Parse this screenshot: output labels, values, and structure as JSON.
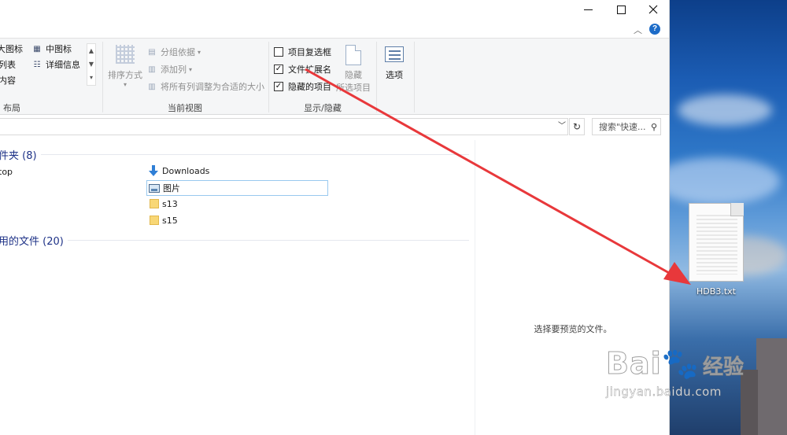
{
  "window": {
    "controls": [
      "minimize",
      "maximize",
      "close"
    ]
  },
  "ribbon": {
    "layout": {
      "items": [
        "大图标",
        "中图标",
        "列表",
        "详细信息",
        "内容"
      ],
      "label": "布局"
    },
    "current_view": {
      "sort_label": "排序方式",
      "group_by_label": "分组依据",
      "add_column_label": "添加列",
      "fit_columns_label": "将所有列调整为合适的大小",
      "label": "当前视图"
    },
    "show_hide": {
      "item_checkboxes_label": "项目复选框",
      "item_checkboxes_checked": false,
      "extensions_label": "文件扩展名",
      "extensions_checked": true,
      "hidden_items_label": "隐藏的项目",
      "hidden_items_checked": true,
      "hide_label": "隐藏",
      "hide_selected_label": "所选项目",
      "label": "显示/隐藏"
    },
    "options_label": "选项"
  },
  "address": {
    "search_placeholder": "搜索\"快速..."
  },
  "content": {
    "folders_group": "件夹 (8)",
    "left_item": "top",
    "items": [
      {
        "name": "Downloads",
        "icon": "download-arrow-icon"
      },
      {
        "name": "图片",
        "icon": "pictures-icon",
        "selected": true
      },
      {
        "name": "s13",
        "icon": "folder-icon"
      },
      {
        "name": "s15",
        "icon": "folder-icon"
      }
    ],
    "recent_group": "用的文件 (20)"
  },
  "preview": {
    "message": "选择要预览的文件。"
  },
  "desktop": {
    "file_label": "HDB3.txt"
  },
  "watermark": {
    "logo": "Bai",
    "logo_tail": "经验",
    "url": "jingyan.baidu.com"
  },
  "colors": {
    "ribbon_bg": "#f5f6f7",
    "group_heading": "#1e3287",
    "annotation_arrow": "#e8383b",
    "help_blue": "#1d6cc8"
  }
}
